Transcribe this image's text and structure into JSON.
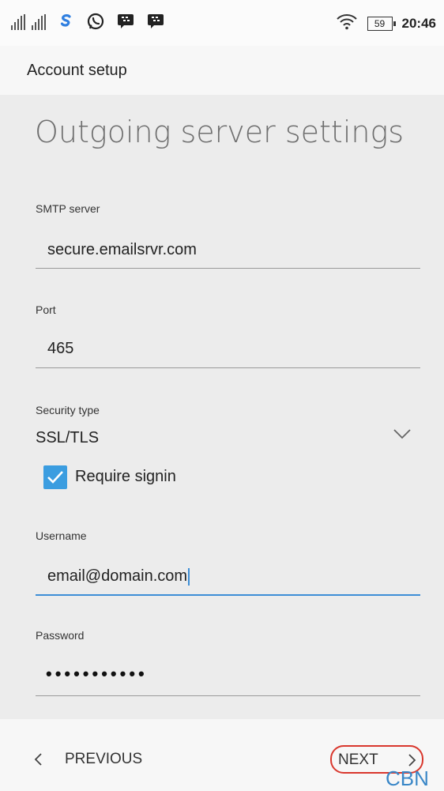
{
  "status_bar": {
    "time": "20:46",
    "battery": "59",
    "icons": [
      "signal-icon",
      "signal-icon",
      "skype-icon",
      "whatsapp-icon",
      "bbm-icon",
      "bbm-icon",
      "wifi-icon",
      "battery-icon"
    ]
  },
  "app_bar": {
    "title": "Account setup"
  },
  "page": {
    "title": "Outgoing server settings"
  },
  "form": {
    "smtp_server": {
      "label": "SMTP server",
      "value": "secure.emailsrvr.com"
    },
    "port": {
      "label": "Port",
      "value": "465"
    },
    "security_type": {
      "label": "Security type",
      "value": "SSL/TLS"
    },
    "require_signin": {
      "label": "Require signin",
      "checked": true
    },
    "username": {
      "label": "Username",
      "value": "email@domain.com"
    },
    "password": {
      "label": "Password",
      "value": "•••••••••••"
    }
  },
  "nav": {
    "previous": "PREVIOUS",
    "next": "NEXT"
  },
  "watermark": "CBN",
  "colors": {
    "accent": "#3b9de0",
    "highlight": "#d9372d"
  }
}
